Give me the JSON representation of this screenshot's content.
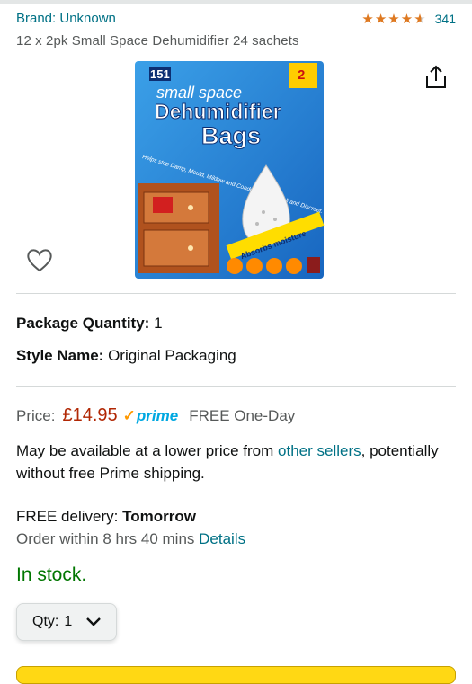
{
  "header": {
    "brand": "Brand: Unknown",
    "rating": {
      "stars": 4.5,
      "count": "341"
    },
    "title": "12 x 2pk Small Space Dehumidifier 24 sachets"
  },
  "product_image": {
    "brand_mark": "151",
    "count_badge": "2",
    "line1": "small space",
    "line2": "Dehumidifier",
    "line3": "Bags",
    "tagline": "Helps stop Damp, Mould, Mildew and Condensation. Small and Discreet.",
    "ribbon": "Absorbs moisture"
  },
  "options": {
    "package_quantity_label": "Package Quantity:",
    "package_quantity_value": "1",
    "style_name_label": "Style Name:",
    "style_name_value": "Original Packaging"
  },
  "price": {
    "label": "Price:",
    "value": "£14.95",
    "prime_check": "✓",
    "prime_text": "prime",
    "free_one_day": "FREE One-Day"
  },
  "availability": {
    "text_before": "May be available at a lower price from ",
    "link": "other sellers",
    "text_after": ", potentially without free Prime shipping."
  },
  "delivery": {
    "label": "FREE delivery: ",
    "day": "Tomorrow",
    "order_within": "Order within 8 hrs 40 mins ",
    "details_link": "Details"
  },
  "stock": "In stock.",
  "quantity": {
    "label": "Qty:",
    "value": "1"
  },
  "colors": {
    "link": "#007185",
    "price": "#b12704",
    "instock": "#007600",
    "star": "#de7921",
    "prime": "#00a8e1"
  },
  "icons": {
    "share": "share-icon",
    "wishlist": "heart-outline-icon",
    "qty_caret": "chevron-down-icon"
  }
}
